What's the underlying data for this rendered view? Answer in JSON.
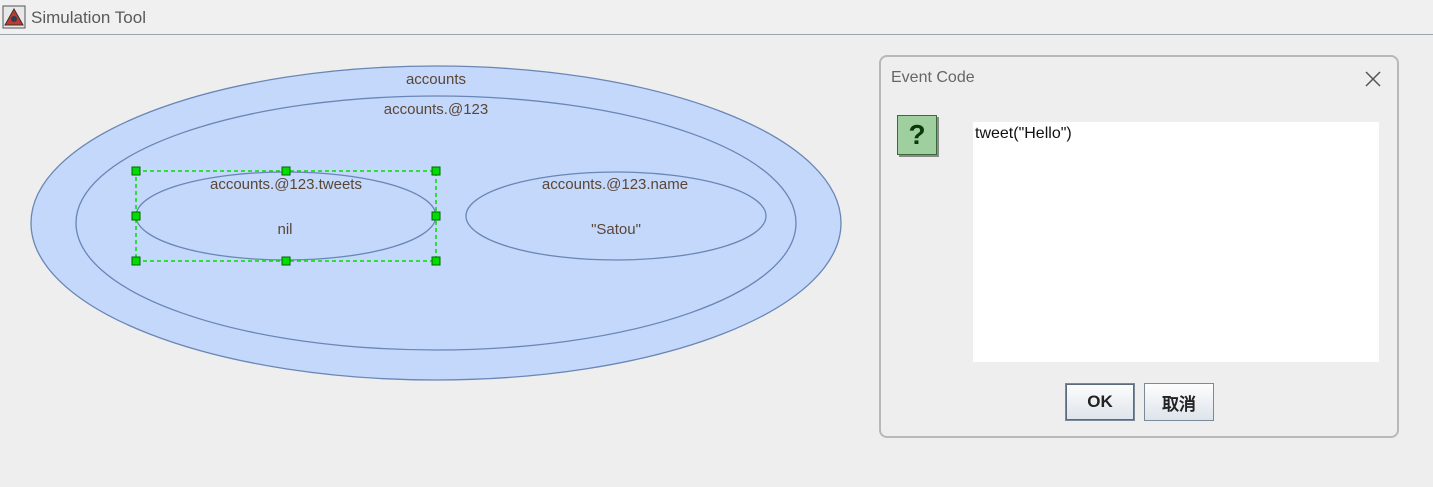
{
  "window": {
    "title": "Simulation Tool"
  },
  "diagram": {
    "outer_label": "accounts",
    "inner_label": "accounts.@123",
    "tweets_label": "accounts.@123.tweets",
    "tweets_value": "nil",
    "name_label": "accounts.@123.name",
    "name_value": "\"Satou\""
  },
  "colors": {
    "fill": "#c3d8fb",
    "stroke": "#6a86b5",
    "selection": "#00dd00"
  },
  "dialog": {
    "title": "Event Code",
    "icon": "question-icon",
    "code": "tweet(\"Hello\")",
    "ok_label": "OK",
    "cancel_label": "取消"
  }
}
